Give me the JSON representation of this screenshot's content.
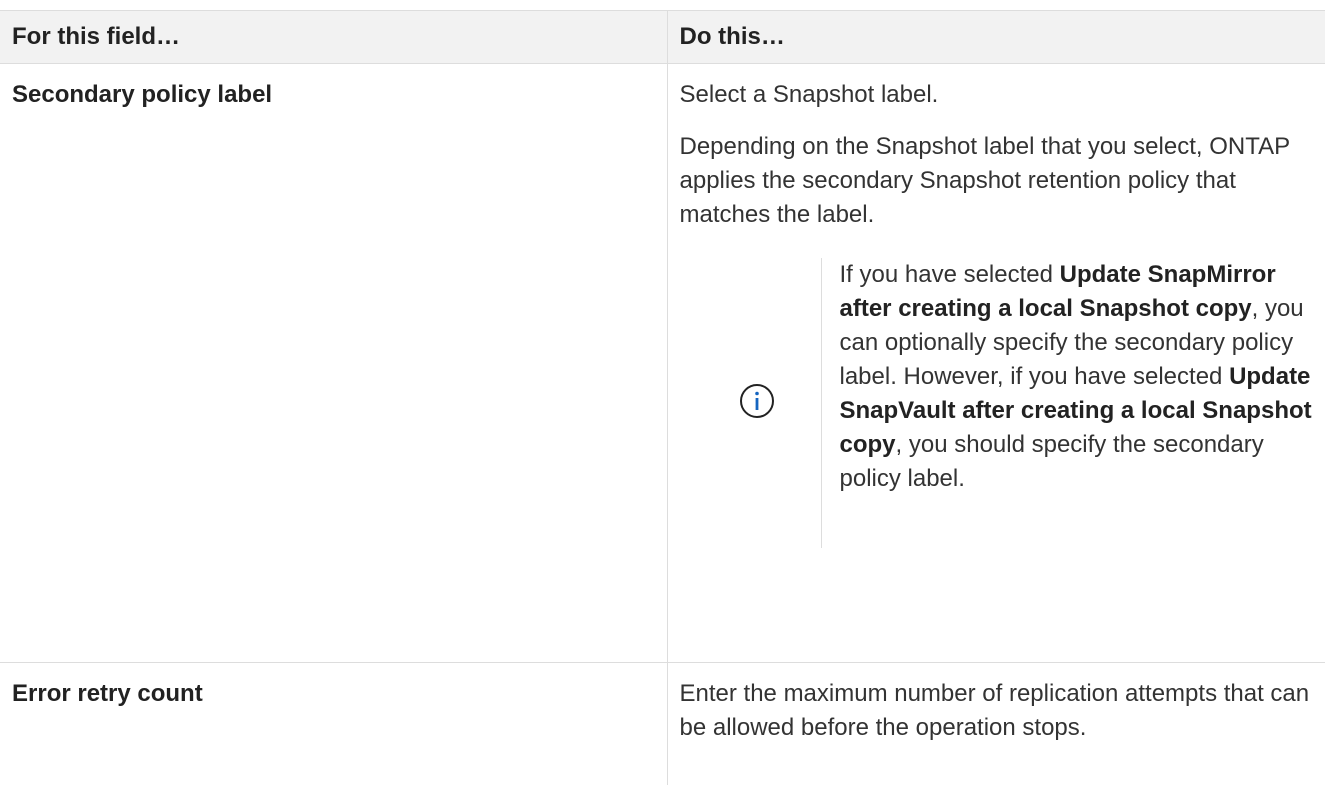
{
  "table": {
    "header_col1": "For this field…",
    "header_col2": "Do this…",
    "rows": [
      {
        "field": "Secondary policy label",
        "para1": "Select a Snapshot label.",
        "para2": "Depending on the Snapshot label that you select, ONTAP applies the secondary Snapshot retention policy that matches the label.",
        "note": {
          "icon": "info-icon",
          "t1": "If you have selected ",
          "b1": "Update SnapMirror after creating a local Snapshot copy",
          "t2": ", you can optionally specify the secondary policy label. However, if you have selected ",
          "b2": "Update SnapVault after creating a local Snapshot copy",
          "t3": ", you should specify the secondary policy label."
        }
      },
      {
        "field": "Error retry count",
        "para1": "Enter the maximum number of replication attempts that can be allowed before the operation stops."
      }
    ]
  },
  "colors": {
    "header_bg": "#f2f2f2",
    "border": "#dddddd",
    "text": "#333333",
    "icon": "#1565c0"
  }
}
